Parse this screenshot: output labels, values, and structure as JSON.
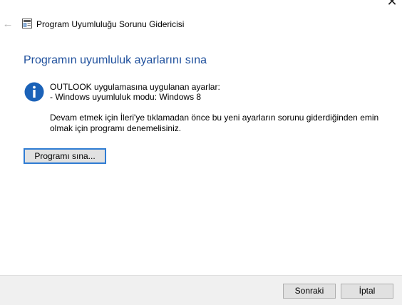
{
  "window": {
    "title": "Program Uyumluluğu Sorunu Gidericisi",
    "back_icon": "back-arrow-icon",
    "close_icon": "close-icon",
    "app_icon": "troubleshooter-icon"
  },
  "main": {
    "heading": "Programın uyumluluk ayarlarını sına",
    "info_icon": "info-icon",
    "settings_intro": "OUTLOOK uygulamasına uygulanan ayarlar:",
    "settings_item": "- Windows uyumluluk modu: Windows 8",
    "instruction": "Devam etmek için İleri'ye tıklamadan önce bu yeni ayarların sorunu giderdiğinden emin olmak için programı denemelisiniz.",
    "test_button_label": "Programı sına..."
  },
  "footer": {
    "next_label": "Sonraki",
    "cancel_label": "İptal"
  },
  "colors": {
    "heading": "#1e4f9c",
    "info_icon_bg": "#1b62b8",
    "focus_border": "#2f7cd3",
    "footer_bg": "#f0f0f0"
  }
}
